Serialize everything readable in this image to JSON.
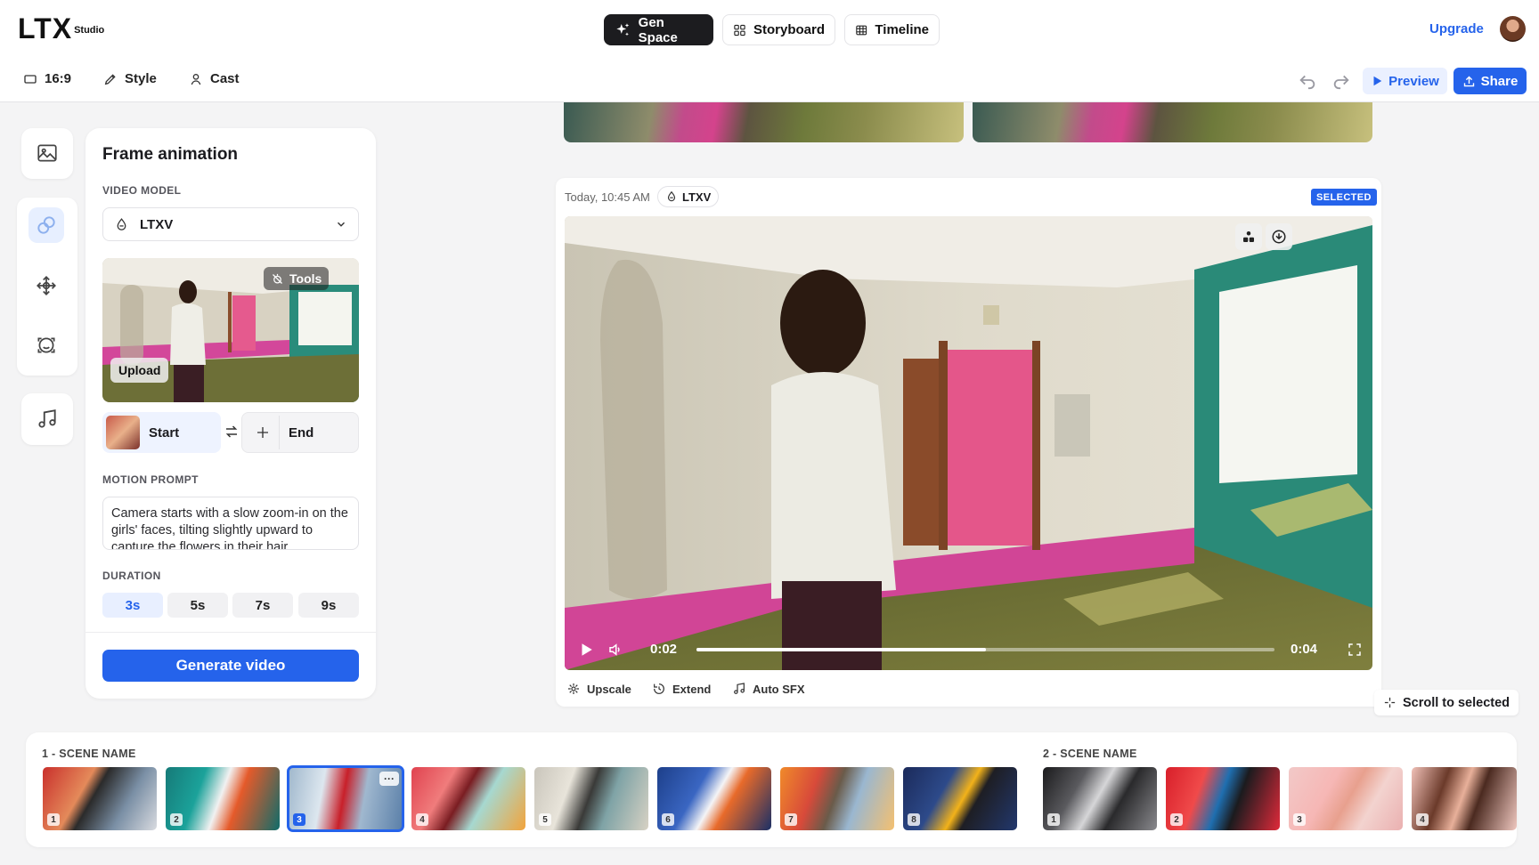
{
  "app": {
    "logo_main": "LTX",
    "logo_sub": "Studio",
    "upgrade_label": "Upgrade"
  },
  "nav": {
    "gen_space": "Gen Space",
    "storyboard": "Storyboard",
    "timeline": "Timeline"
  },
  "subbar": {
    "aspect": "16:9",
    "style": "Style",
    "cast": "Cast",
    "preview": "Preview",
    "share": "Share"
  },
  "panel": {
    "title": "Frame animation",
    "video_model_label": "VIDEO MODEL",
    "model_value": "LTXV",
    "tools_label": "Tools",
    "upload_label": "Upload",
    "start_label": "Start",
    "end_label": "End",
    "motion_prompt_label": "MOTION PROMPT",
    "motion_prompt": "Camera starts with a slow zoom-in on the girls' faces, tilting slightly upward to capture the flowers in their hair.",
    "duration_label": "DURATION",
    "durations": [
      "3s",
      "5s",
      "7s",
      "9s"
    ],
    "duration_selected": "3s",
    "generate_label": "Generate video"
  },
  "card": {
    "timestamp": "Today, 10:45 AM",
    "model_chip": "LTXV",
    "selected_badge": "SELECTED",
    "time_current": "0:02",
    "time_total": "0:04",
    "progress": 0.5,
    "actions": [
      "Upscale",
      "Extend",
      "Auto SFX"
    ]
  },
  "scroll_to_selected": "Scroll to selected",
  "scenes": [
    {
      "label": "1 - SCENE NAME",
      "shots": [
        "1",
        "2",
        "3",
        "4",
        "5",
        "6",
        "7",
        "8"
      ],
      "selected": "3"
    },
    {
      "label": "2 - SCENE NAME",
      "shots": [
        "1",
        "2",
        "3",
        "4"
      ]
    }
  ],
  "colors": {
    "accent": "#2563eb",
    "active_nav": "#1c1c1f"
  },
  "icons": [
    "sparkle-icon",
    "grid-icon",
    "timeline-icon",
    "aspect-ratio-icon",
    "brush-icon",
    "person-icon",
    "undo-icon",
    "redo-icon",
    "play-icon",
    "upload-icon",
    "image-icon",
    "link-icon",
    "move-icon",
    "face-scan-icon",
    "music-icon",
    "chevron-down-icon",
    "swap-icon",
    "plus-icon",
    "volume-icon",
    "fullscreen-icon",
    "download-icon",
    "upscale-icon",
    "extend-icon",
    "crosshair-icon",
    "more-icon"
  ]
}
